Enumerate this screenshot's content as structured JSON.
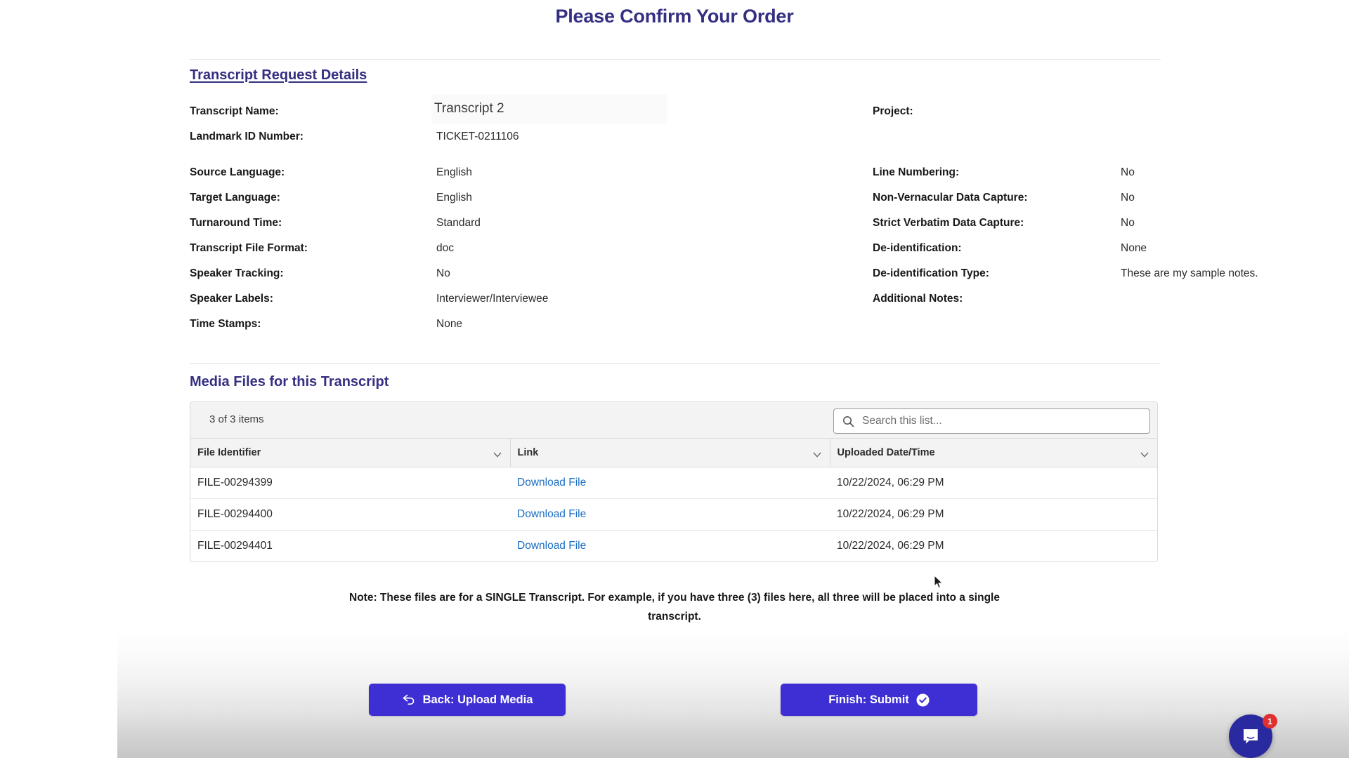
{
  "page": {
    "title": "Please Confirm Your Order"
  },
  "request_details": {
    "heading": "Transcript Request Details",
    "left_column": [
      {
        "label": "Transcript Name:",
        "value": "Transcript  2"
      },
      {
        "label": "Landmark ID Number:",
        "value": "TICKET-0211106"
      },
      {
        "label": "Source Language:",
        "value": "English"
      },
      {
        "label": "Target Language:",
        "value": "English"
      },
      {
        "label": "Turnaround Time:",
        "value": "Standard"
      },
      {
        "label": "Transcript File Format:",
        "value": "doc"
      },
      {
        "label": "Speaker Tracking:",
        "value": "No"
      },
      {
        "label": "Speaker Labels:",
        "value": "Interviewer/Interviewee"
      },
      {
        "label": "Time Stamps:",
        "value": "None"
      }
    ],
    "right_column": [
      {
        "label": "Project:",
        "value": ""
      },
      {
        "label": "Line Numbering:",
        "value": "No"
      },
      {
        "label": "Non-Vernacular Data Capture:",
        "value": "No"
      },
      {
        "label": "Strict Verbatim Data Capture:",
        "value": "No"
      },
      {
        "label": "De-identification:",
        "value": "None"
      },
      {
        "label": "De-identification Type:",
        "value": "These are my sample notes."
      },
      {
        "label": "Additional Notes:",
        "value": ""
      }
    ],
    "transcript_name_value": "Transcript  2"
  },
  "media_files": {
    "heading": "Media Files for this Transcript",
    "items_count": "3 of 3 items",
    "search": {
      "placeholder": "Search this list...",
      "value": ""
    },
    "columns": [
      "File Identifier",
      "Link",
      "Uploaded Date/Time"
    ],
    "rows": [
      {
        "file_identifier": "FILE-00294399",
        "link_label": "Download File",
        "uploaded": "10/22/2024, 06:29 PM"
      },
      {
        "file_identifier": "FILE-00294400",
        "link_label": "Download File",
        "uploaded": "10/22/2024, 06:29 PM"
      },
      {
        "file_identifier": "FILE-00294401",
        "link_label": "Download File",
        "uploaded": "10/22/2024, 06:29 PM"
      }
    ],
    "note_line_1": "Note: These files are for a SINGLE Transcript. For example, if you have three (3) files here, all three will be",
    "note_line_2": "placed into a single transcript."
  },
  "footer": {
    "back_label": "Back: Upload Media",
    "finish_label": "Finish: Submit"
  },
  "chat": {
    "badge_count": "1"
  },
  "colors": {
    "brand_purple": "#342f81",
    "button_purple": "#3d2fd4",
    "link_blue": "#1b6ec2",
    "chat_blue": "#2a2aa0",
    "badge_red": "#e03030"
  }
}
